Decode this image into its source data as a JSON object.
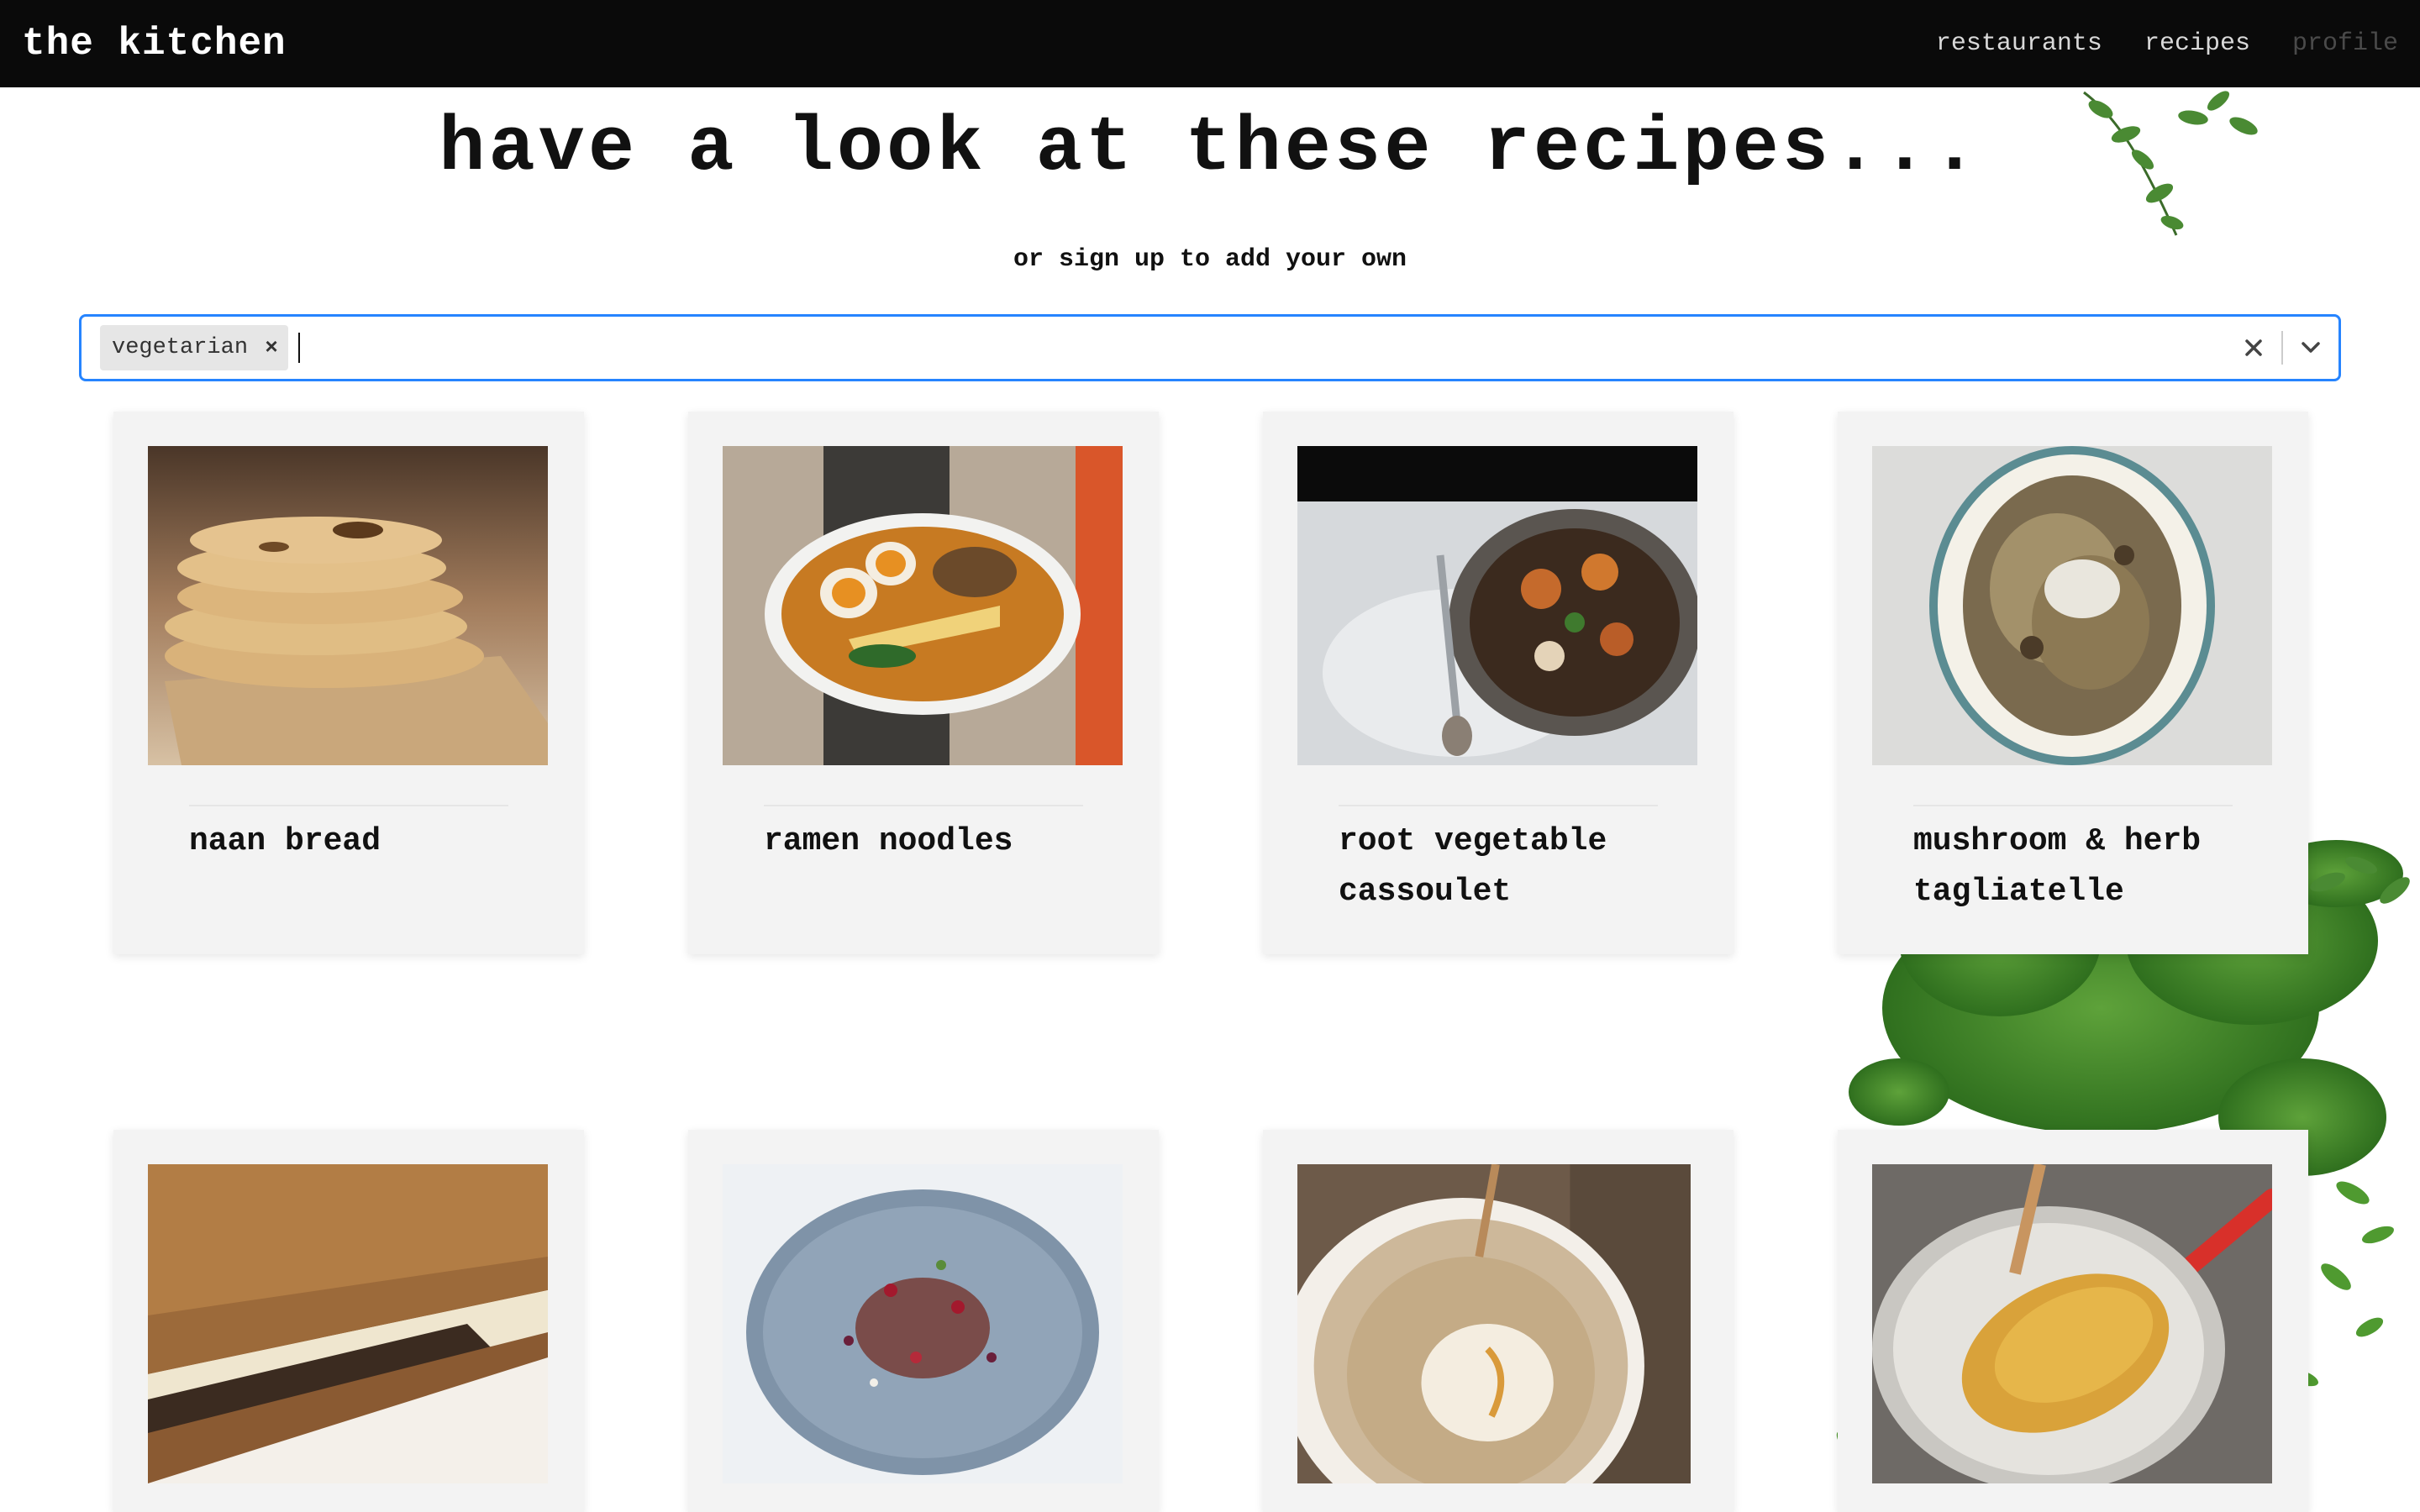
{
  "nav": {
    "brand": "the kitchen",
    "links": [
      "restaurants",
      "recipes",
      "profile"
    ]
  },
  "hero": {
    "title": "have a look at these recipes...",
    "subtitle": "or sign up to add your own"
  },
  "filter": {
    "selected_tags": [
      "vegetarian"
    ],
    "input_value": "",
    "remove_tag_glyph": "×",
    "clear_icon": "close-icon",
    "dropdown_icon": "chevron-down-icon",
    "focus_color": "#2684ff"
  },
  "recipes": [
    {
      "title": "naan bread"
    },
    {
      "title": "ramen noodles"
    },
    {
      "title": "root vegetable cassoulet"
    },
    {
      "title": "mushroom & herb tagliatelle"
    },
    {
      "title": ""
    },
    {
      "title": ""
    },
    {
      "title": ""
    },
    {
      "title": ""
    }
  ],
  "colors": {
    "nav_bg": "#0a0a0a",
    "card_bg": "#f3f3f3",
    "foliage": "#3f8a2c"
  }
}
